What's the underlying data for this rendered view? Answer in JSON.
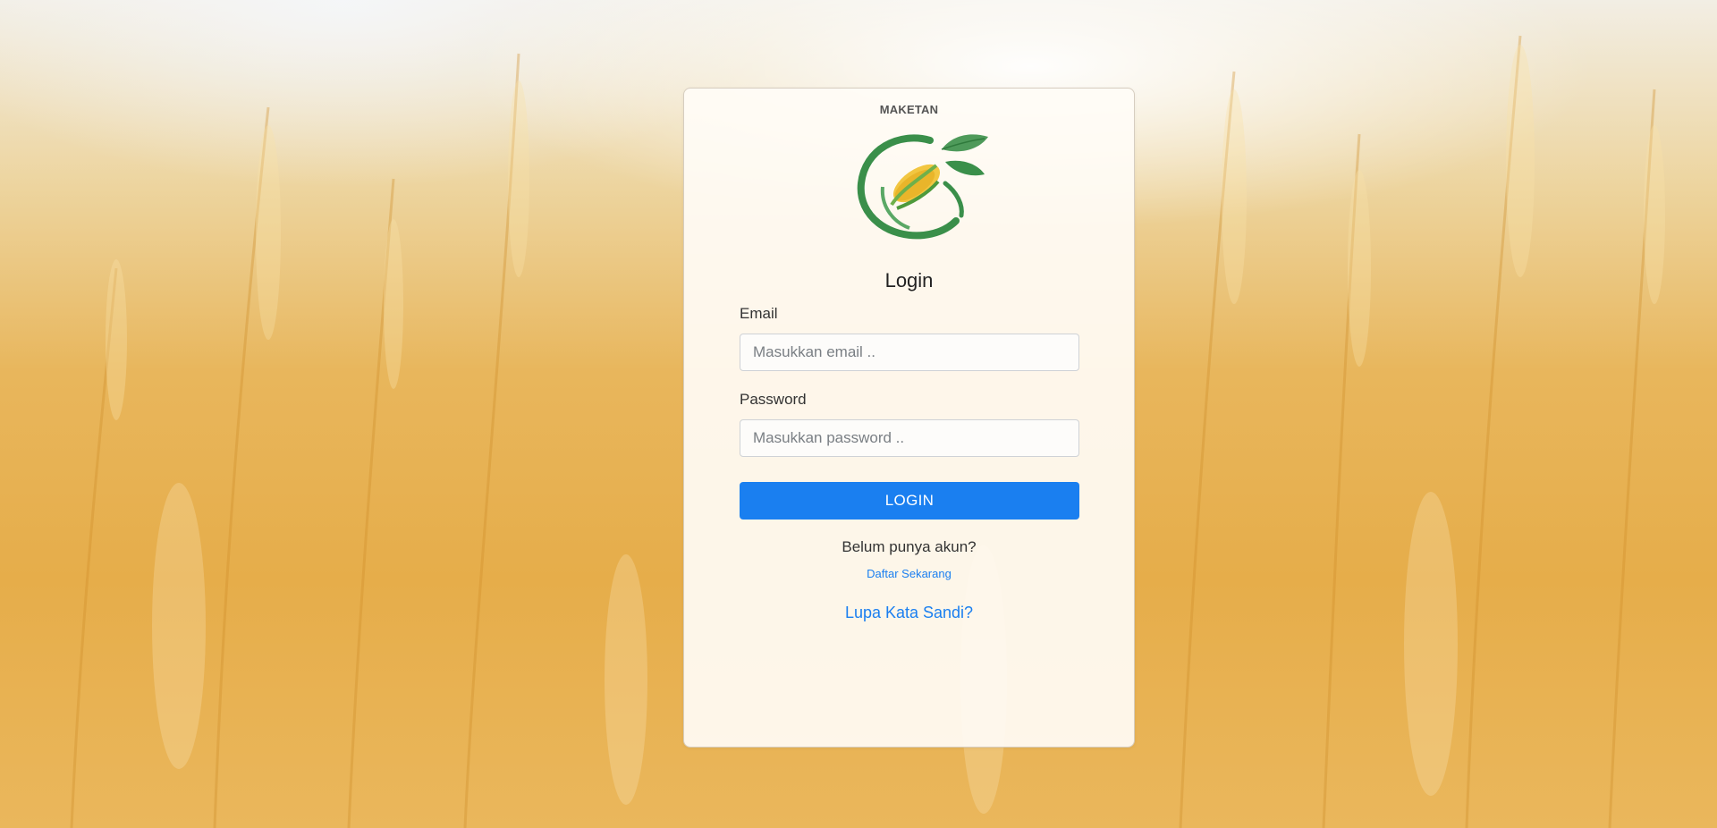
{
  "brand": "MAKETAN",
  "login": {
    "title": "Login",
    "email_label": "Email",
    "email_placeholder": "Masukkan email ..",
    "password_label": "Password",
    "password_placeholder": "Masukkan password ..",
    "submit_label": "LOGIN",
    "no_account_text": "Belum punya akun?",
    "register_link": "Daftar Sekarang",
    "forgot_link": "Lupa Kata Sandi?"
  },
  "colors": {
    "primary": "#1a7ff0",
    "logo_green": "#3a8f4a",
    "background": "#e6ad4a"
  },
  "icons": {
    "logo": "corn-leaf-logo"
  }
}
